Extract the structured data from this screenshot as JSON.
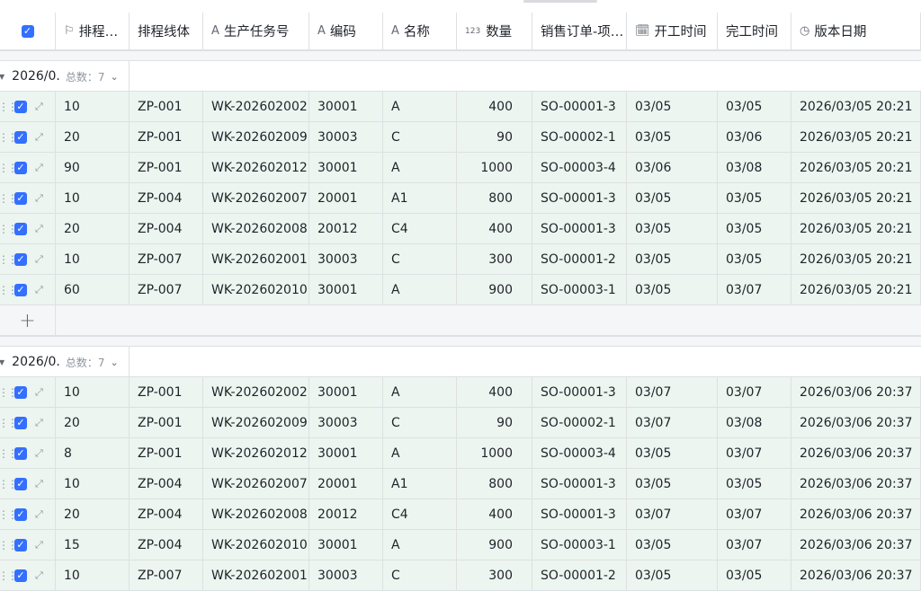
{
  "columns": [
    {
      "label": "排程…",
      "icon": "flag-icon",
      "glyph": "⚐"
    },
    {
      "label": "排程线体",
      "icon": "",
      "glyph": ""
    },
    {
      "label": "生产任务号",
      "icon": "text-type-icon",
      "glyph": "A"
    },
    {
      "label": "编码",
      "icon": "text-type-icon",
      "glyph": "A"
    },
    {
      "label": "名称",
      "icon": "text-type-icon",
      "glyph": "A"
    },
    {
      "label": "数量",
      "icon": "number-type-icon",
      "glyph": "123"
    },
    {
      "label": "销售订单-项…",
      "icon": "",
      "glyph": ""
    },
    {
      "label": "开工时间",
      "icon": "calendar-icon",
      "glyph": "🗓"
    },
    {
      "label": "完工时间",
      "icon": "",
      "glyph": ""
    },
    {
      "label": "版本日期",
      "icon": "clock-icon",
      "glyph": "◷"
    }
  ],
  "groups": [
    {
      "label": "2026/0.",
      "count_label": "总数：7",
      "rows": [
        [
          "10",
          "ZP-001",
          "WK-202602002",
          "30001",
          "A",
          "400",
          "SO-00001-3",
          "03/05",
          "03/05",
          "2026/03/05 20:21"
        ],
        [
          "20",
          "ZP-001",
          "WK-202602009",
          "30003",
          "C",
          "90",
          "SO-00002-1",
          "03/05",
          "03/06",
          "2026/03/05 20:21"
        ],
        [
          "90",
          "ZP-001",
          "WK-202602012",
          "30001",
          "A",
          "1000",
          "SO-00003-4",
          "03/06",
          "03/08",
          "2026/03/05 20:21"
        ],
        [
          "10",
          "ZP-004",
          "WK-202602007",
          "20001",
          "A1",
          "800",
          "SO-00001-3",
          "03/05",
          "03/05",
          "2026/03/05 20:21"
        ],
        [
          "20",
          "ZP-004",
          "WK-202602008",
          "20012",
          "C4",
          "400",
          "SO-00001-3",
          "03/05",
          "03/05",
          "2026/03/05 20:21"
        ],
        [
          "10",
          "ZP-007",
          "WK-202602001",
          "30003",
          "C",
          "300",
          "SO-00001-2",
          "03/05",
          "03/05",
          "2026/03/05 20:21"
        ],
        [
          "60",
          "ZP-007",
          "WK-202602010",
          "30001",
          "A",
          "900",
          "SO-00003-1",
          "03/05",
          "03/07",
          "2026/03/05 20:21"
        ]
      ]
    },
    {
      "label": "2026/0.",
      "count_label": "总数：7",
      "rows": [
        [
          "10",
          "ZP-001",
          "WK-202602002",
          "30001",
          "A",
          "400",
          "SO-00001-3",
          "03/07",
          "03/07",
          "2026/03/06 20:37"
        ],
        [
          "20",
          "ZP-001",
          "WK-202602009",
          "30003",
          "C",
          "90",
          "SO-00002-1",
          "03/07",
          "03/08",
          "2026/03/06 20:37"
        ],
        [
          "8",
          "ZP-001",
          "WK-202602012",
          "30001",
          "A",
          "1000",
          "SO-00003-4",
          "03/05",
          "03/07",
          "2026/03/06 20:37"
        ],
        [
          "10",
          "ZP-004",
          "WK-202602007",
          "20001",
          "A1",
          "800",
          "SO-00001-3",
          "03/05",
          "03/05",
          "2026/03/06 20:37"
        ],
        [
          "20",
          "ZP-004",
          "WK-202602008",
          "20012",
          "C4",
          "400",
          "SO-00001-3",
          "03/07",
          "03/07",
          "2026/03/06 20:37"
        ],
        [
          "15",
          "ZP-004",
          "WK-202602010",
          "30001",
          "A",
          "900",
          "SO-00003-1",
          "03/05",
          "03/07",
          "2026/03/06 20:37"
        ],
        [
          "10",
          "ZP-007",
          "WK-202602001",
          "30003",
          "C",
          "300",
          "SO-00001-2",
          "03/05",
          "03/05",
          "2026/03/06 20:37"
        ]
      ]
    }
  ],
  "colors": {
    "accent": "#3370ff",
    "row_bg": "#edf5f0",
    "border": "#dee0e3"
  }
}
